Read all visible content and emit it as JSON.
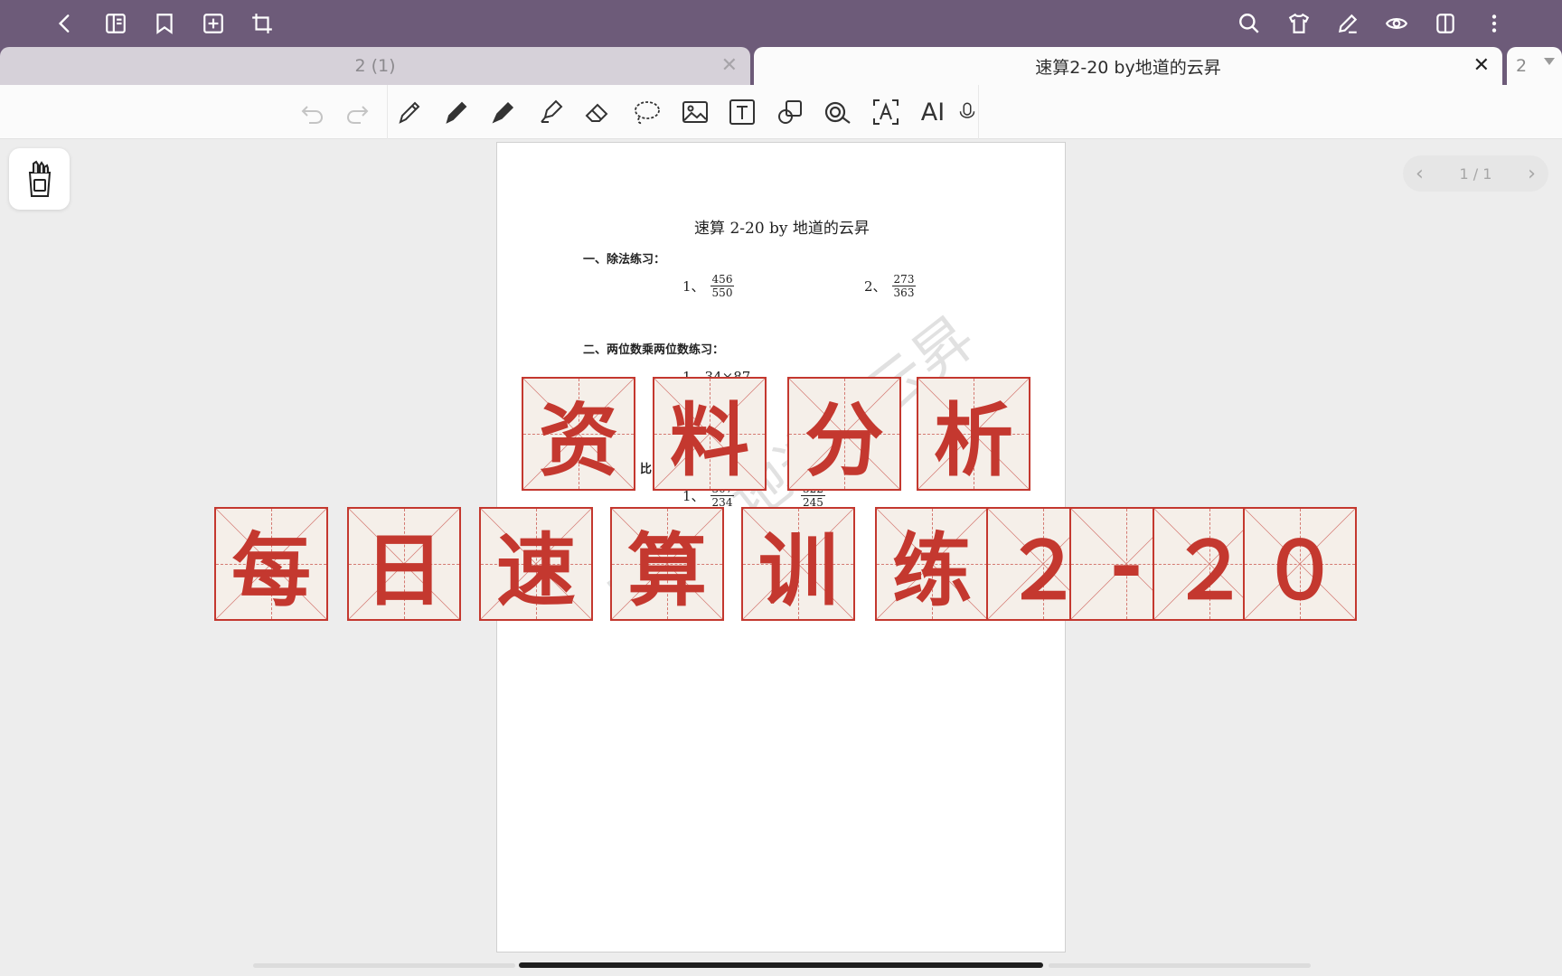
{
  "topbar": {
    "color": "#6d5b79",
    "left_icons": [
      "back-icon",
      "sidebar-icon",
      "bookmark-icon",
      "add-page-icon",
      "crop-icon"
    ],
    "right_icons": [
      "search-icon",
      "theme-icon",
      "edit-icon",
      "eye-icon",
      "layout-icon",
      "more-icon"
    ]
  },
  "tabs": {
    "inactive_label": "2 (1)",
    "active_label": "速算2-20 by地道的云昇",
    "extra_label": "2"
  },
  "toolbar": {
    "tools": [
      "undo-icon",
      "redo-icon",
      "pen-icon",
      "pencil-icon",
      "fountain-pen-icon",
      "highlighter-icon",
      "eraser-icon",
      "lasso-icon",
      "image-icon",
      "text-icon",
      "shape-icon",
      "tape-icon",
      "ocr-icon",
      "ai-icon",
      "mic-icon"
    ],
    "ai_label": "AI"
  },
  "pager": {
    "label": "1 / 1"
  },
  "document": {
    "title": "速算 2-20 by 地道的云昇",
    "section1": "一、除法练习：",
    "p1_label": "1、",
    "p1_num": "456",
    "p1_den": "550",
    "p2_label": "2、",
    "p2_num": "273",
    "p2_den": "363",
    "section2": "二、两位数乘两位数练习：",
    "s2_item": "1、34×87",
    "section3_partial": "比",
    "s3_item_label": "1、",
    "s3_f1_num": "307",
    "s3_f1_den": "234",
    "s3_f2_num": "322",
    "s3_f2_den": "245",
    "watermark": "B站：地道的云昇"
  },
  "overlay": {
    "row1": [
      "资",
      "料",
      "分",
      "析"
    ],
    "row2": [
      "每",
      "日",
      "速",
      "算",
      "训",
      "练",
      "２",
      "-",
      "２",
      "０"
    ],
    "color": "#c4382f"
  }
}
